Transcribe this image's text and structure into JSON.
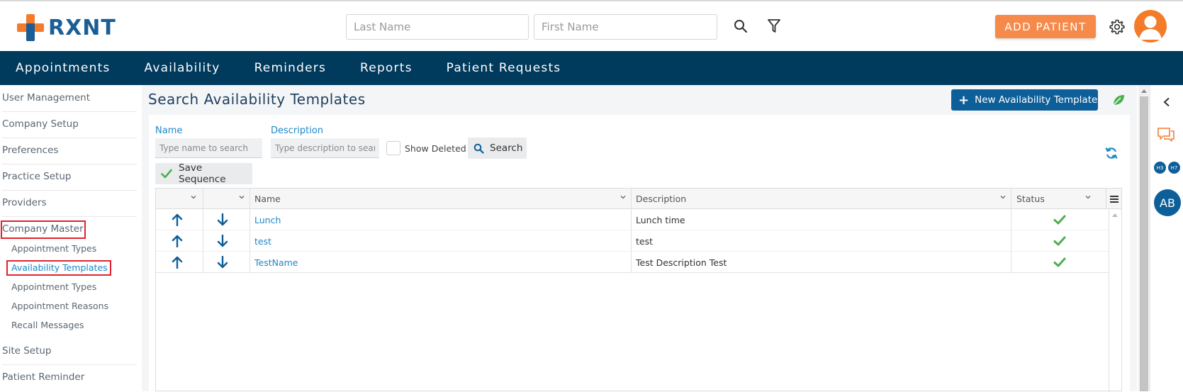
{
  "brand": {
    "name": "RXNT"
  },
  "header": {
    "last_name_placeholder": "Last Name",
    "first_name_placeholder": "First Name",
    "add_patient_label": "ADD PATIENT"
  },
  "nav": [
    "Appointments",
    "Availability",
    "Reminders",
    "Reports",
    "Patient Requests"
  ],
  "sidebar": {
    "items": [
      "User Management",
      "Company Setup",
      "Preferences",
      "Practice Setup",
      "Providers",
      "Company Master"
    ],
    "sub_items": [
      "Appointment Types",
      "Availability Templates",
      "Appointment Types",
      "Appointment Reasons",
      "Recall Messages"
    ],
    "items_after": [
      "Site Setup",
      "Patient Reminder"
    ]
  },
  "page": {
    "title": "Search Availability Templates",
    "new_button": "New Availability Template"
  },
  "form": {
    "name_label": "Name",
    "name_placeholder": "Type name to search",
    "description_label": "Description",
    "description_placeholder": "Type description to search",
    "show_deleted_label": "Show Deleted",
    "show_deleted_checked": false,
    "search_button": "Search",
    "save_sequence_button": "Save Sequence"
  },
  "grid": {
    "columns": [
      "Name",
      "Description",
      "Status"
    ],
    "rows": [
      {
        "name": "Lunch",
        "description": "Lunch time",
        "status": "active"
      },
      {
        "name": "test",
        "description": "test",
        "status": "active"
      },
      {
        "name": "TestName",
        "description": "Test Description Test",
        "status": "active"
      }
    ]
  },
  "right_rail": {
    "badge_1": "H3",
    "badge_2": "H7",
    "user_initials": "AB"
  },
  "colors": {
    "primary_navy": "#003a5d",
    "accent_orange": "#f58a4b",
    "link_blue": "#1e88c8",
    "button_blue": "#0d5f99",
    "check_green": "#4caf50",
    "highlight_red": "#e3222d"
  }
}
